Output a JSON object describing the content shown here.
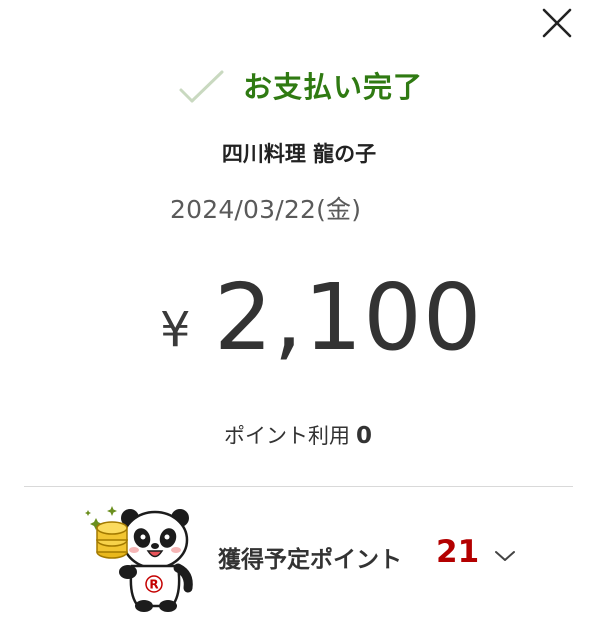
{
  "status": {
    "title": "お支払い完了",
    "check_icon": "check-icon",
    "color": "#2f7a12"
  },
  "payment": {
    "store_name": "四川料理 龍の子",
    "date": "2024/03/22(金)",
    "currency_symbol": "¥",
    "amount": "2,100"
  },
  "points_used": {
    "label": "ポイント利用",
    "value": "0"
  },
  "points_earned": {
    "label": "獲得予定ポイント",
    "value": "21",
    "value_color": "#b30000",
    "expand_icon": "chevron-down-icon",
    "mascot_badge": "R"
  },
  "close_icon": "close-icon"
}
